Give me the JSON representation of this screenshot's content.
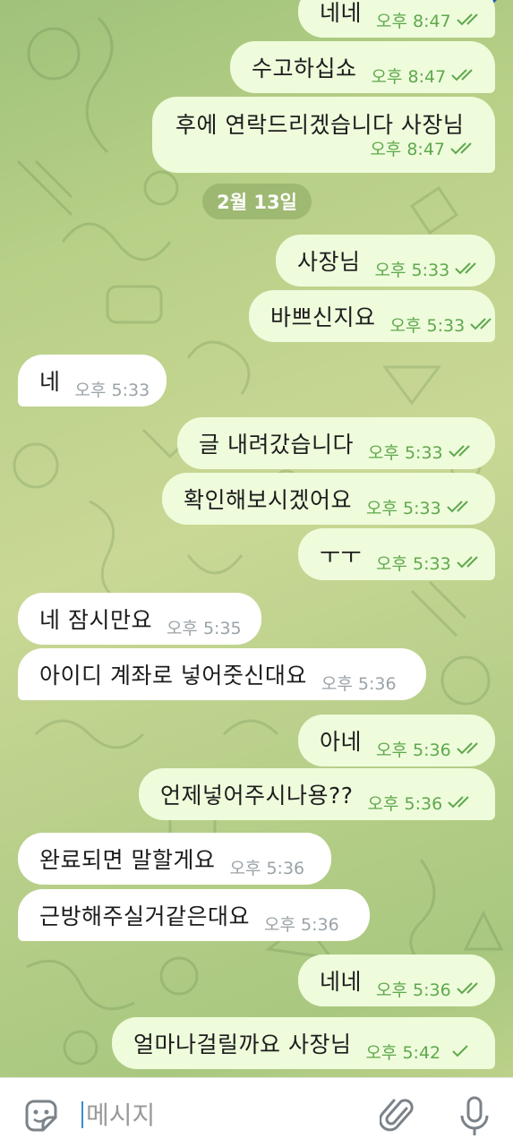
{
  "date_separator": "2월 13일",
  "messages": [
    {
      "dir": "out",
      "text": "네네",
      "time": "오후 8:47",
      "status": "read"
    },
    {
      "dir": "out",
      "text": "수고하십쇼",
      "time": "오후 8:47",
      "status": "read"
    },
    {
      "dir": "out",
      "text": "후에 연락드리겠습니다 사장님",
      "time": "오후 8:47",
      "status": "read"
    },
    {
      "dir": "out",
      "text": "사장님",
      "time": "오후 5:33",
      "status": "read"
    },
    {
      "dir": "out",
      "text": "바쁘신지요",
      "time": "오후 5:33",
      "status": "read"
    },
    {
      "dir": "in",
      "text": "네",
      "time": "오후 5:33"
    },
    {
      "dir": "out",
      "text": "글 내려갔습니다",
      "time": "오후 5:33",
      "status": "read"
    },
    {
      "dir": "out",
      "text": "확인해보시겠어요",
      "time": "오후 5:33",
      "status": "read"
    },
    {
      "dir": "out",
      "text": "ㅜㅜ",
      "time": "오후 5:33",
      "status": "read"
    },
    {
      "dir": "in",
      "text": "네 잠시만요",
      "time": "오후 5:35"
    },
    {
      "dir": "in",
      "text": "아이디 계좌로 넣어줏신대요",
      "time": "오후 5:36"
    },
    {
      "dir": "out",
      "text": "아네",
      "time": "오후 5:36",
      "status": "read"
    },
    {
      "dir": "out",
      "text": "언제넣어주시나용??",
      "time": "오후 5:36",
      "status": "read"
    },
    {
      "dir": "in",
      "text": "완료되면 말할게요",
      "time": "오후 5:36"
    },
    {
      "dir": "in",
      "text": "근방해주실거같은대요",
      "time": "오후 5:36"
    },
    {
      "dir": "out",
      "text": "네네",
      "time": "오후 5:36",
      "status": "read"
    },
    {
      "dir": "out",
      "text": "얼마나걸릴까요 사장님",
      "time": "오후 5:42",
      "status": "sent"
    }
  ],
  "input": {
    "placeholder": "메시지"
  },
  "icons": {
    "sticker": "sticker-icon",
    "attach": "paperclip-icon",
    "mic": "microphone-icon",
    "read_receipt": "double-check-icon",
    "sent_receipt": "single-check-icon"
  },
  "colors": {
    "outgoing_bubble": "#eefcdc",
    "incoming_bubble": "#ffffff",
    "outgoing_meta": "#5fa84c",
    "incoming_meta": "#9aa3a8",
    "caret": "#3a8bd8"
  }
}
